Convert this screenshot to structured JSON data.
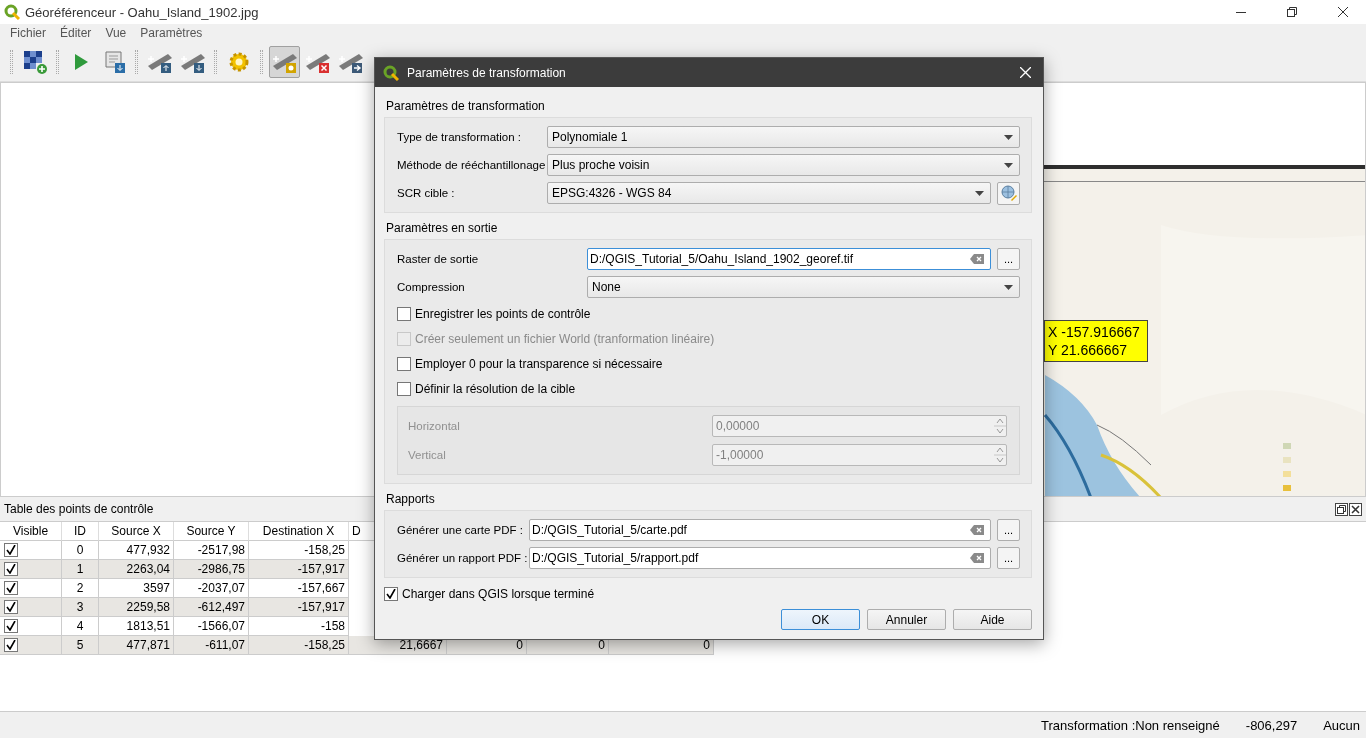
{
  "window": {
    "title": "Géoréférenceur - Oahu_Island_1902.jpg"
  },
  "menu": [
    "Fichier",
    "Éditer",
    "Vue",
    "Paramètres"
  ],
  "toolbar": [
    {
      "selected": false
    },
    {
      "selected": false
    },
    {
      "selected": false
    },
    {
      "selected": false
    },
    {
      "selected": false
    },
    {
      "selected": false
    },
    {
      "selected": true
    },
    {
      "selected": false
    },
    {
      "selected": false
    }
  ],
  "canvas": {
    "annotation": [
      "X -157.916667",
      "Y 21.666667"
    ]
  },
  "gcp_table": {
    "title": "Table des points de contrôle",
    "columns": [
      "Visible",
      "ID",
      "Source X",
      "Source Y",
      "Destination X",
      "D"
    ],
    "rows": [
      {
        "cells": [
          {
            "checked": true
          },
          "0",
          "477,932",
          "-2517,98",
          "-158,25"
        ]
      },
      {
        "cells": [
          {
            "checked": true
          },
          "1",
          "2263,04",
          "-2986,75",
          "-157,917"
        ]
      },
      {
        "cells": [
          {
            "checked": true
          },
          "2",
          "3597",
          "-2037,07",
          "-157,667"
        ]
      },
      {
        "cells": [
          {
            "checked": true
          },
          "3",
          "2259,58",
          "-612,497",
          "-157,917"
        ]
      },
      {
        "cells": [
          {
            "checked": true
          },
          "4",
          "1813,51",
          "-1566,07",
          "-158"
        ]
      },
      {
        "cells": [
          {
            "checked": true
          },
          "5",
          "477,871",
          "-611,07",
          "-158,25",
          "21,6667",
          "0",
          "0",
          "0"
        ]
      }
    ]
  },
  "status_bar": {
    "transformation": "Transformation :Non renseigné",
    "coordinate": "-806,297",
    "crs": "Aucun"
  },
  "dialog": {
    "title": "Paramètres de transformation",
    "transform_section": {
      "title": "Paramètres de transformation",
      "fields": [
        {
          "kind": "combo",
          "label": "Type de transformation :",
          "value": "Polynomiale 1"
        },
        {
          "kind": "combo",
          "label": "Méthode de rééchantillonage",
          "value": "Plus proche voisin"
        },
        {
          "kind": "crs",
          "label": "SCR cible :",
          "value": "EPSG:4326 - WGS 84"
        }
      ]
    },
    "output_section": {
      "title": "Paramètres en sortie",
      "raster": {
        "label": "Raster de sortie",
        "value": "D:/QGIS_Tutorial_5/Oahu_Island_1902_georef.tif",
        "focused": true,
        "browse": "..."
      },
      "compression": {
        "label": "Compression",
        "value": "None"
      },
      "options": [
        {
          "label": "Enregistrer les points de contrôle",
          "checked": false,
          "disabled": false
        },
        {
          "label": "Créer seulement un fichier World (tranformation linéaire)",
          "checked": false,
          "disabled": true
        },
        {
          "label": "Employer 0 pour la transparence si nécessaire",
          "checked": false,
          "disabled": false
        },
        {
          "label": "Définir la résolution de la cible",
          "checked": false,
          "disabled": false
        }
      ],
      "resolution": {
        "disabled": true,
        "fields": [
          {
            "label": "Horizontal",
            "value": "0,00000"
          },
          {
            "label": "Vertical",
            "value": "-1,00000"
          }
        ]
      }
    },
    "reports_section": {
      "title": "Rapports",
      "fields": [
        {
          "label": "Générer une carte PDF :",
          "value": "D:/QGIS_Tutorial_5/carte.pdf",
          "browse": "..."
        },
        {
          "label": "Générer un rapport PDF :",
          "value": "D:/QGIS_Tutorial_5/rapport.pdf",
          "browse": "..."
        }
      ]
    },
    "load_in_qgis": {
      "label": "Charger dans QGIS lorsque terminé",
      "checked": true
    },
    "buttons": [
      {
        "label": "OK",
        "default": true
      },
      {
        "label": "Annuler",
        "default": false
      },
      {
        "label": "Aide",
        "default": false
      }
    ]
  }
}
